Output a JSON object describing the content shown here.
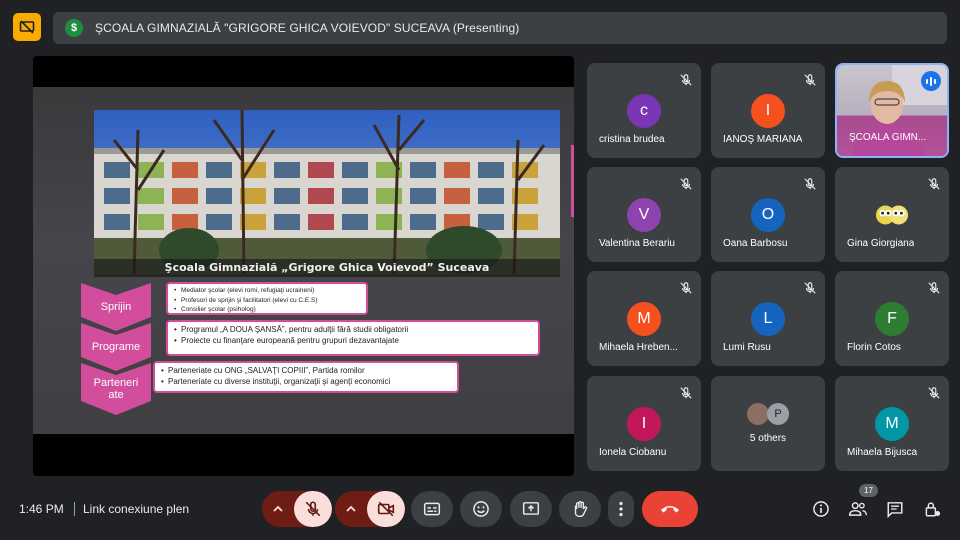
{
  "presentation": {
    "title": "ŞCOALA GIMNAZIALĂ \"GRIGORE GHICA VOIEVOD\" SUCEAVA (Presenting)",
    "badge_letter": "$",
    "slide": {
      "caption": "Şcoala Gimnazială „Grigore Ghica Voievod” Suceava",
      "sections": [
        {
          "label": "Sprijin",
          "items": [
            "Mediator şcolar (elevi romi, refugiaţi ucraineni)",
            "Profesori de sprijin şi facilitatori (elevi cu C.E.S)",
            "Consilier şcolar (psiholog)"
          ]
        },
        {
          "label": "Programe",
          "items": [
            "Programul „A DOUA ŞANSĂ”, pentru adulţii fără studii obligatorii",
            "Proiecte cu finanţare europeană pentru grupuri dezavantajate"
          ]
        },
        {
          "label": "Parteneri ate",
          "items": [
            "Parteneriate cu ONG „SALVAŢI COPIII”, Partida romilor",
            "Parteneriate cu diverse instituţii, organizaţii şi agenţi economici"
          ]
        }
      ]
    }
  },
  "participants": [
    {
      "name": "cristina brudea",
      "initial": "c",
      "color": "#7b36b5"
    },
    {
      "name": "IANOŞ MARIANA",
      "initial": "I",
      "color": "#f4511e"
    },
    {
      "name": "ŞCOALA GIMN...",
      "video": true
    },
    {
      "name": "Valentina Berariu",
      "initial": "V",
      "color": "#8e44ad"
    },
    {
      "name": "Oana Barbosu",
      "initial": "O",
      "color": "#1565c0"
    },
    {
      "name": "Gina Giorgiana",
      "emoji": "owls"
    },
    {
      "name": "Mihaela Hreben...",
      "initial": "M",
      "color": "#f4511e"
    },
    {
      "name": "Lumi Rusu",
      "initial": "L",
      "color": "#1565c0"
    },
    {
      "name": "Florin Cotos",
      "initial": "F",
      "color": "#2e7d32"
    },
    {
      "name": "Ionela Ciobanu",
      "initial": "I",
      "color": "#c2185b"
    },
    {
      "name": "5 others",
      "group": true,
      "group_initial": "P"
    },
    {
      "name": "Mihaela Bijusca",
      "initial": "M",
      "color": "#0097a7"
    }
  ],
  "bottom": {
    "time": "1:46 PM",
    "meeting_name": "Link conexiune plen",
    "people_count": "17"
  },
  "icons": {
    "top_left": "present-off-icon",
    "mic": "mic-off-icon",
    "camera": "camera-off-icon",
    "captions": "captions-icon",
    "emoji": "emoji-icon",
    "present": "present-screen-icon",
    "hand": "raise-hand-icon",
    "more": "more-vert-icon",
    "end_call": "end-call-icon",
    "info": "info-icon",
    "people": "people-icon",
    "chat": "chat-icon",
    "host_controls": "lock-person-icon"
  },
  "colors": {
    "accent_pink": "#d24d9c",
    "end_call": "#ea4335",
    "present_badge": "#1e8e3e"
  }
}
